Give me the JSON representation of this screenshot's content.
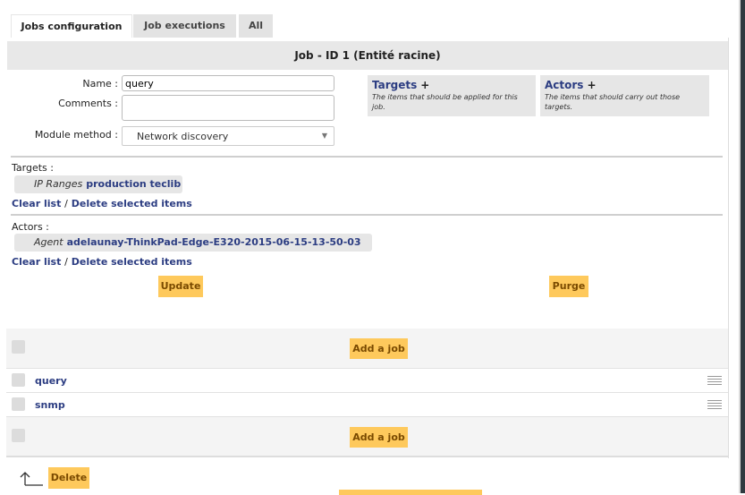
{
  "tabs": [
    {
      "label": "Jobs configuration",
      "active": true
    },
    {
      "label": "Job executions",
      "active": false
    },
    {
      "label": "All",
      "active": false
    }
  ],
  "job": {
    "title": "Job - ID 1 (Entité racine)",
    "name_label": "Name :",
    "name_value": "query",
    "comments_label": "Comments :",
    "comments_value": "",
    "module_label": "Module method :",
    "module_value": "Network discovery"
  },
  "targets_box": {
    "title": "Targets",
    "plus": "+",
    "desc": "The items that should be applied for this job."
  },
  "actors_box": {
    "title": "Actors",
    "plus": "+",
    "desc": "The items that should carry out those targets."
  },
  "targets_section": {
    "label": "Targets :",
    "item_type": "IP Ranges",
    "item_name": "production teclib",
    "clear": "Clear list",
    "sep": "/",
    "delete": "Delete selected items"
  },
  "actors_section": {
    "label": "Actors :",
    "item_type": "Agent",
    "item_name": "adelaunay-ThinkPad-Edge-E320-2015-06-15-13-50-03",
    "clear": "Clear list",
    "sep": "/",
    "delete": "Delete selected items"
  },
  "buttons": {
    "update": "Update",
    "purge": "Purge",
    "add_job": "Add a job",
    "delete": "Delete"
  },
  "jobs": [
    "query",
    "snmp"
  ],
  "colors": {
    "accent_button": "#fec95c",
    "link": "#2c3d82",
    "panel_gray": "#e6e6e6"
  }
}
